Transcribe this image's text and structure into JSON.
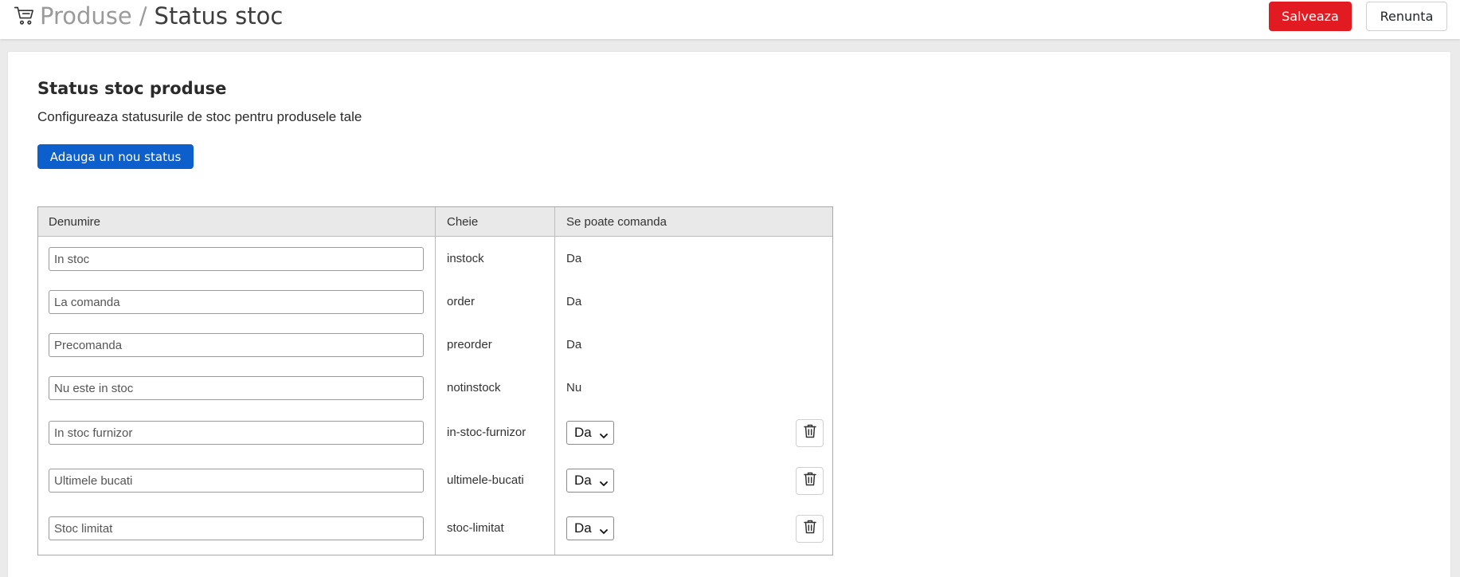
{
  "header": {
    "breadcrumb_parent": "Produse",
    "breadcrumb_separator": "/",
    "breadcrumb_current": "Status stoc",
    "save_label": "Salveaza",
    "cancel_label": "Renunta",
    "icon": "shopping-cart-icon"
  },
  "section": {
    "title": "Status stoc produse",
    "subtitle": "Configureaza statusurile de stoc pentru produsele tale",
    "add_button_label": "Adauga un nou status"
  },
  "table": {
    "columns": [
      "Denumire",
      "Cheie",
      "Se poate comanda"
    ],
    "rows": [
      {
        "name": "In stoc",
        "key": "instock",
        "orderable": "Da",
        "editable": false
      },
      {
        "name": "La comanda",
        "key": "order",
        "orderable": "Da",
        "editable": false
      },
      {
        "name": "Precomanda",
        "key": "preorder",
        "orderable": "Da",
        "editable": false
      },
      {
        "name": "Nu este in stoc",
        "key": "notinstock",
        "orderable": "Nu",
        "editable": false
      },
      {
        "name": "In stoc furnizor",
        "key": "in-stoc-furnizor",
        "orderable": "Da",
        "editable": true
      },
      {
        "name": "Ultimele bucati",
        "key": "ultimele-bucati",
        "orderable": "Da",
        "editable": true
      },
      {
        "name": "Stoc limitat",
        "key": "stoc-limitat",
        "orderable": "Da",
        "editable": true
      }
    ]
  },
  "colors": {
    "save": "#e21b22",
    "primary": "#0d5fcc",
    "header_row": "#e9e9ea"
  }
}
